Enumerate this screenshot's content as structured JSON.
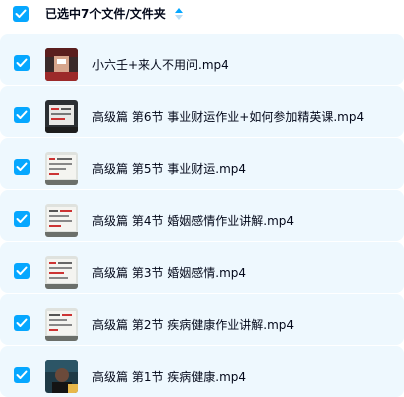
{
  "header": {
    "selection_text": "已选中7个文件/文件夹",
    "sort_icon": "sort-arrows-icon"
  },
  "colors": {
    "checkbox": "#06a7ff",
    "row_background": "#eef8fe",
    "text": "#03081a"
  },
  "files": [
    {
      "name": "小六壬+来人不用问.mp4",
      "checked": true,
      "thumbnail": "video-thumbnail-red-room"
    },
    {
      "name": "高级篇 第6节 事业财运作业+如何参加精英课.mp4",
      "checked": true,
      "thumbnail": "video-thumbnail-board"
    },
    {
      "name": "高级篇 第5节 事业财运.mp4",
      "checked": true,
      "thumbnail": "video-thumbnail-board"
    },
    {
      "name": "高级篇 第4节 婚姻感情作业讲解.mp4",
      "checked": true,
      "thumbnail": "video-thumbnail-board"
    },
    {
      "name": "高级篇 第3节 婚姻感情.mp4",
      "checked": true,
      "thumbnail": "video-thumbnail-board"
    },
    {
      "name": "高级篇 第2节 疾病健康作业讲解.mp4",
      "checked": true,
      "thumbnail": "video-thumbnail-board"
    },
    {
      "name": "高级篇 第1节 疾病健康.mp4",
      "checked": true,
      "thumbnail": "video-thumbnail-presenter"
    }
  ]
}
